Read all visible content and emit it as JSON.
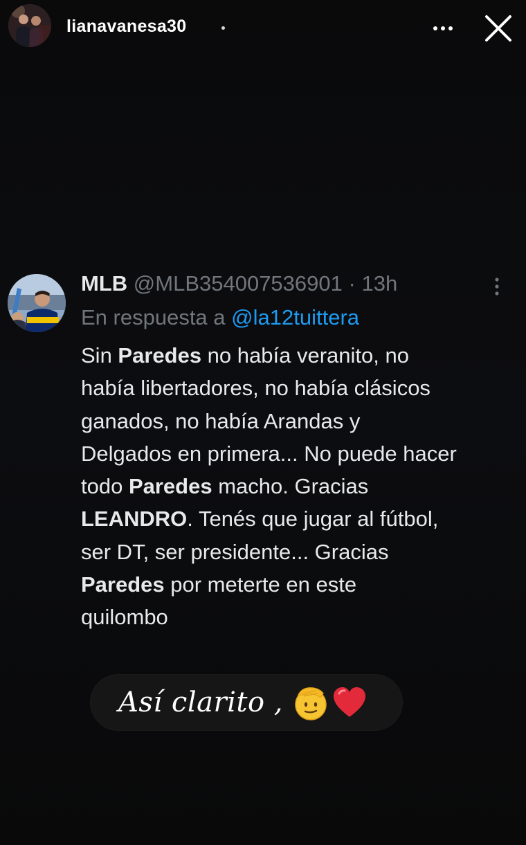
{
  "story": {
    "username": "lianavanesa30",
    "more_icon": "more-horizontal-icon",
    "close_icon": "close-icon",
    "background_color": "#000000"
  },
  "tweet": {
    "display_name": "MLB",
    "handle": "@MLB354007536901",
    "separator": "·",
    "age": "13h",
    "reply_prefix": "En respuesta a",
    "reply_to": "@la12tuittera",
    "body_lines": [
      [
        {
          "t": "Sin "
        },
        {
          "t": "Paredes",
          "b": true
        },
        {
          "t": " no había veranito, no"
        }
      ],
      [
        {
          "t": "había libertadores, no había clásicos"
        }
      ],
      [
        {
          "t": "ganados, no había Arandas y"
        }
      ],
      [
        {
          "t": "Delgados en primera... No puede hacer"
        }
      ],
      [
        {
          "t": "todo "
        },
        {
          "t": "Paredes",
          "b": true
        },
        {
          "t": " macho. Gracias"
        }
      ],
      [
        {
          "t": "LEANDRO",
          "b": true
        },
        {
          "t": ". Tenés que jugar al fútbol,"
        }
      ],
      [
        {
          "t": "ser DT, ser presidente... Gracias"
        }
      ],
      [
        {
          "t": "Paredes",
          "b": true
        },
        {
          "t": " por meterte en este"
        }
      ],
      [
        {
          "t": "quilombo"
        }
      ]
    ],
    "link_color": "#1d9bf0",
    "muted_color": "#71767b",
    "text_color": "#e7e9ea"
  },
  "caption": {
    "text": "Así clarito ,",
    "emojis": [
      "saluting-face-icon",
      "red-heart-icon"
    ]
  }
}
